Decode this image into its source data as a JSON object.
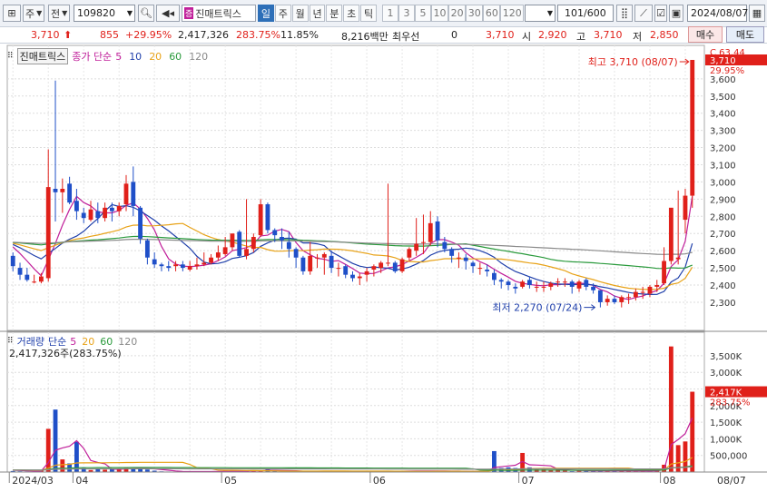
{
  "toolbar": {
    "market": "주",
    "kind": "전",
    "code": "109820",
    "name": "진매트릭스",
    "periods": [
      "일",
      "주",
      "월",
      "년",
      "분",
      "초",
      "틱"
    ],
    "active_period": "일",
    "intervals": [
      "1",
      "3",
      "5",
      "10",
      "20",
      "30",
      "60",
      "120"
    ],
    "count": "101",
    "count_total": "/600",
    "date": "2024/08/07"
  },
  "quote": {
    "price": "3,710",
    "change": "855",
    "change_pct": "+29.95%",
    "volume": "2,417,326",
    "vol_ratio": "283.75%",
    "turnover": "11.85%",
    "amount": "8,216백만",
    "best_bid_label": "최우선",
    "best_bid": "0",
    "ask_price": "3,710",
    "open_label": "시",
    "open": "2,920",
    "high_label": "고",
    "high": "3,710",
    "low_label": "저",
    "low": "2,850",
    "buy_label": "매수",
    "sell_label": "매도"
  },
  "price_panel": {
    "name": "진매트릭스",
    "ma_label": "종가 단순",
    "ma_periods": [
      "5",
      "10",
      "20",
      "60",
      "120"
    ],
    "ma_colors": [
      "#c01f9a",
      "#1f3faa",
      "#e8a217",
      "#2a9a3c",
      "#8a8a8a"
    ],
    "high_note": "최고 3,710 (08/07)",
    "low_note": "최저 2,270 (07/24)",
    "axis_top": "C 63.44",
    "last_price": "3,710",
    "last_pct": "29.95%",
    "y_ticks": [
      "3,600",
      "3,500",
      "3,400",
      "3,300",
      "3,200",
      "3,100",
      "3,000",
      "2,900",
      "2,800",
      "2,700",
      "2,600",
      "2,500",
      "2,400",
      "2,300"
    ]
  },
  "vol_panel": {
    "title": "거래량",
    "ma_label": "단순",
    "ma_periods": [
      "5",
      "20",
      "60",
      "120"
    ],
    "ma_colors": [
      "#c01f9a",
      "#e8a217",
      "#2a9a3c",
      "#8a8a8a"
    ],
    "current": "2,417,326주(283.75%)",
    "last_value": "2,417K",
    "last_pct": "283.75%",
    "y_ticks": [
      "3,500K",
      "3,000K",
      "2,500K",
      "2,000K",
      "1,500K",
      "1,000K",
      "500,000"
    ]
  },
  "x_labels": [
    "2024/03",
    "04",
    "05",
    "06",
    "07",
    "08",
    "08/07"
  ],
  "chart_data": {
    "type": "candlestick",
    "dates": [
      "03/19",
      "03/20",
      "03/21",
      "03/22",
      "03/25",
      "03/26",
      "03/27",
      "03/28",
      "03/29",
      "04/01",
      "04/02",
      "04/03",
      "04/04",
      "04/05",
      "04/08",
      "04/09",
      "04/11",
      "04/12",
      "04/15",
      "04/16",
      "04/17",
      "04/18",
      "04/19",
      "04/22",
      "04/23",
      "04/24",
      "04/25",
      "04/26",
      "04/29",
      "04/30",
      "05/02",
      "05/03",
      "05/07",
      "05/08",
      "05/09",
      "05/10",
      "05/13",
      "05/14",
      "05/16",
      "05/17",
      "05/20",
      "05/21",
      "05/22",
      "05/23",
      "05/24",
      "05/27",
      "05/28",
      "05/29",
      "05/30",
      "05/31",
      "06/03",
      "06/04",
      "06/05",
      "06/07",
      "06/10",
      "06/11",
      "06/12",
      "06/13",
      "06/14",
      "06/17",
      "06/18",
      "06/19",
      "06/20",
      "06/21",
      "06/24",
      "06/25",
      "06/26",
      "06/27",
      "06/28",
      "07/01",
      "07/02",
      "07/03",
      "07/04",
      "07/05",
      "07/08",
      "07/09",
      "07/10",
      "07/11",
      "07/12",
      "07/15",
      "07/16",
      "07/17",
      "07/18",
      "07/19",
      "07/22",
      "07/23",
      "07/24",
      "07/25",
      "07/26",
      "07/29",
      "07/30",
      "07/31",
      "08/01",
      "08/02",
      "08/05",
      "08/06",
      "08/07"
    ],
    "open": [
      2570,
      2500,
      2460,
      2420,
      2420,
      2440,
      2960,
      2940,
      2990,
      2890,
      2820,
      2780,
      2830,
      2790,
      2850,
      2830,
      2870,
      3000,
      2850,
      2660,
      2550,
      2520,
      2510,
      2510,
      2520,
      2490,
      2510,
      2520,
      2530,
      2560,
      2580,
      2620,
      2710,
      2570,
      2610,
      2690,
      2870,
      2720,
      2680,
      2650,
      2610,
      2560,
      2480,
      2560,
      2560,
      2570,
      2500,
      2510,
      2460,
      2440,
      2460,
      2490,
      2500,
      2530,
      2530,
      2480,
      2560,
      2600,
      2650,
      2650,
      2770,
      2650,
      2610,
      2560,
      2560,
      2530,
      2500,
      2490,
      2470,
      2430,
      2420,
      2390,
      2390,
      2430,
      2390,
      2390,
      2390,
      2420,
      2420,
      2420,
      2380,
      2430,
      2390,
      2370,
      2300,
      2320,
      2300,
      2330,
      2330,
      2360,
      2350,
      2390,
      2410,
      2540,
      2550,
      2780,
      2920
    ],
    "high": [
      2590,
      2530,
      2500,
      2460,
      2470,
      3190,
      3590,
      3020,
      3030,
      2960,
      2850,
      2890,
      2880,
      2880,
      2880,
      2880,
      3040,
      3090,
      2860,
      2670,
      2590,
      2530,
      2540,
      2540,
      2540,
      2540,
      2560,
      2590,
      2580,
      2630,
      2680,
      2690,
      2720,
      2900,
      2700,
      2900,
      2880,
      2730,
      2730,
      2710,
      2620,
      2570,
      2650,
      2580,
      2590,
      2600,
      2530,
      2520,
      2480,
      2470,
      2500,
      2520,
      2540,
      2990,
      2540,
      2560,
      2620,
      2790,
      2810,
      2830,
      2800,
      2680,
      2620,
      2590,
      2580,
      2540,
      2530,
      2520,
      2490,
      2440,
      2430,
      2410,
      2430,
      2450,
      2420,
      2420,
      2420,
      2440,
      2440,
      2430,
      2430,
      2440,
      2410,
      2370,
      2340,
      2340,
      2340,
      2350,
      2380,
      2390,
      2400,
      2430,
      2620,
      2830,
      2950,
      2960,
      3710
    ],
    "low": [
      2480,
      2430,
      2420,
      2410,
      2410,
      2420,
      2770,
      2820,
      2870,
      2780,
      2760,
      2770,
      2760,
      2770,
      2770,
      2800,
      2830,
      2800,
      2640,
      2520,
      2500,
      2480,
      2480,
      2480,
      2480,
      2480,
      2490,
      2510,
      2520,
      2540,
      2570,
      2600,
      2560,
      2550,
      2590,
      2680,
      2700,
      2650,
      2610,
      2560,
      2500,
      2460,
      2460,
      2500,
      2460,
      2470,
      2450,
      2440,
      2420,
      2400,
      2420,
      2450,
      2470,
      2510,
      2470,
      2470,
      2540,
      2570,
      2580,
      2630,
      2620,
      2590,
      2530,
      2500,
      2490,
      2470,
      2460,
      2450,
      2400,
      2380,
      2370,
      2350,
      2380,
      2380,
      2360,
      2360,
      2370,
      2390,
      2390,
      2350,
      2360,
      2370,
      2350,
      2270,
      2280,
      2290,
      2270,
      2290,
      2310,
      2320,
      2330,
      2360,
      2400,
      2520,
      2520,
      2700,
      2850
    ],
    "close": [
      2510,
      2460,
      2430,
      2420,
      2450,
      2970,
      2940,
      2960,
      2880,
      2830,
      2790,
      2840,
      2790,
      2850,
      2830,
      2860,
      2990,
      2860,
      2670,
      2560,
      2520,
      2510,
      2500,
      2520,
      2500,
      2510,
      2520,
      2530,
      2560,
      2590,
      2620,
      2700,
      2570,
      2610,
      2680,
      2870,
      2720,
      2690,
      2660,
      2610,
      2560,
      2480,
      2570,
      2560,
      2580,
      2500,
      2500,
      2460,
      2440,
      2450,
      2480,
      2510,
      2530,
      2530,
      2480,
      2550,
      2610,
      2640,
      2650,
      2760,
      2660,
      2610,
      2570,
      2560,
      2540,
      2510,
      2500,
      2480,
      2430,
      2420,
      2400,
      2380,
      2420,
      2400,
      2390,
      2390,
      2410,
      2420,
      2420,
      2390,
      2420,
      2390,
      2370,
      2300,
      2320,
      2300,
      2330,
      2330,
      2360,
      2360,
      2390,
      2400,
      2540,
      2850,
      2560,
      2920,
      3710
    ],
    "volume": [
      30,
      22,
      18,
      15,
      60,
      1300,
      1880,
      380,
      260,
      910,
      120,
      60,
      90,
      70,
      100,
      90,
      130,
      110,
      120,
      75,
      40,
      20,
      15,
      15,
      10,
      15,
      10,
      20,
      20,
      15,
      40,
      25,
      30,
      45,
      35,
      40,
      90,
      35,
      20,
      25,
      15,
      25,
      20,
      30,
      20,
      15,
      20,
      10,
      15,
      10,
      20,
      15,
      25,
      40,
      25,
      20,
      30,
      40,
      30,
      35,
      25,
      20,
      30,
      20,
      15,
      15,
      10,
      15,
      630,
      120,
      140,
      120,
      575,
      140,
      80,
      80,
      60,
      80,
      40,
      25,
      40,
      30,
      40,
      40,
      30,
      45,
      30,
      30,
      25,
      30,
      40,
      50,
      220,
      3780,
      810,
      920,
      2417
    ],
    "ma_periods": [
      5,
      10,
      20,
      60,
      120
    ],
    "volume_unit": "K"
  }
}
